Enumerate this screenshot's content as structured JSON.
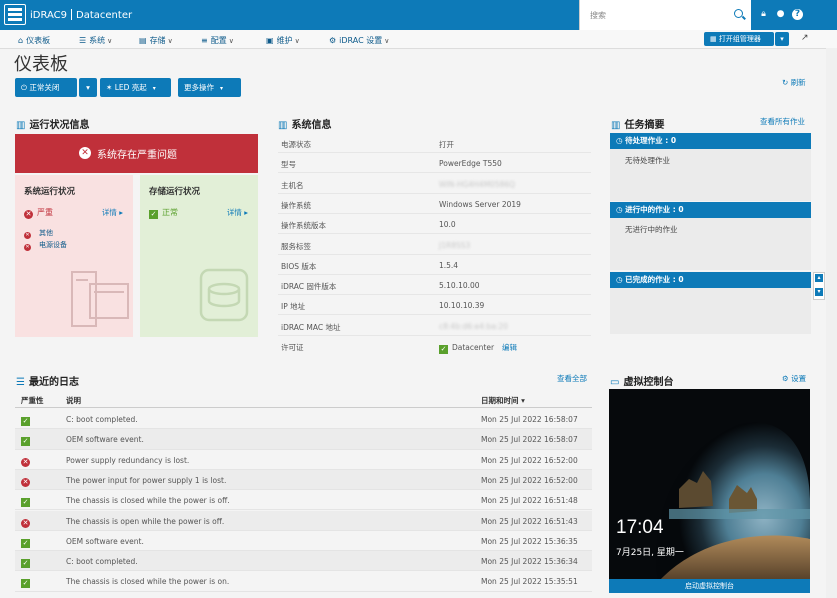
{
  "app": {
    "brand": "iDRAC9",
    "edition": "Datacenter"
  },
  "search": {
    "placeholder": "搜索"
  },
  "nav": [
    {
      "label": "仪表板"
    },
    {
      "label": "系统"
    },
    {
      "label": "存储"
    },
    {
      "label": "配置"
    },
    {
      "label": "维护"
    },
    {
      "label": "iDRAC 设置"
    }
  ],
  "group_manager": {
    "label": "打开组管理器"
  },
  "page": {
    "title": "仪表板",
    "refresh": "刷新"
  },
  "actions": {
    "shutdown": "正常关闭",
    "led": "LED 亮起",
    "more": "更多操作"
  },
  "health": {
    "title": "运行状况信息",
    "alert": "系统存在严重问题",
    "system": {
      "title": "系统运行状况",
      "status": "严重",
      "detail": "详情",
      "items": [
        "其他",
        "电源设备"
      ]
    },
    "storage": {
      "title": "存储运行状况",
      "status": "正常",
      "detail": "详情"
    }
  },
  "sysinfo": {
    "title": "系统信息",
    "rows": [
      {
        "k": "电源状态",
        "v": "打开"
      },
      {
        "k": "型号",
        "v": "PowerEdge T550"
      },
      {
        "k": "主机名",
        "v": "WIN-HG4H4M0586Q"
      },
      {
        "k": "操作系统",
        "v": "Windows Server 2019"
      },
      {
        "k": "操作系统版本",
        "v": "10.0"
      },
      {
        "k": "服务标签",
        "v": "J1R8SS3"
      },
      {
        "k": "BIOS 版本",
        "v": "1.5.4"
      },
      {
        "k": "iDRAC 固件版本",
        "v": "5.10.10.00"
      },
      {
        "k": "IP 地址",
        "v": "10.10.10.39"
      },
      {
        "k": "iDRAC MAC 地址",
        "v": "c8:4b:d6:e4:ba:20"
      },
      {
        "k": "许可证",
        "v": "Datacenter",
        "link": "编辑"
      }
    ]
  },
  "tasks": {
    "title": "任务摘要",
    "view_all": "查看所有作业",
    "pending": {
      "label": "待处理作业 : 0",
      "text": "无待处理作业"
    },
    "running": {
      "label": "进行中的作业 : 0",
      "text": "无进行中的作业"
    },
    "done": {
      "label": "已完成的作业 : 0"
    }
  },
  "logs": {
    "title": "最近的日志",
    "view_all": "查看全部",
    "headers": {
      "severity": "严重性",
      "desc": "说明",
      "date": "日期和时间"
    },
    "rows": [
      {
        "sev": "ok",
        "msg": "C: boot completed.",
        "date": "Mon 25 Jul 2022 16:58:07"
      },
      {
        "sev": "ok",
        "msg": "OEM software event.",
        "date": "Mon 25 Jul 2022 16:58:07"
      },
      {
        "sev": "error",
        "msg": "Power supply redundancy is lost.",
        "date": "Mon 25 Jul 2022 16:52:00"
      },
      {
        "sev": "error",
        "msg": "The power input for power supply 1 is lost.",
        "date": "Mon 25 Jul 2022 16:52:00"
      },
      {
        "sev": "ok",
        "msg": "The chassis is closed while the power is off.",
        "date": "Mon 25 Jul 2022 16:51:48"
      },
      {
        "sev": "error",
        "msg": "The chassis is open while the power is off.",
        "date": "Mon 25 Jul 2022 16:51:43"
      },
      {
        "sev": "ok",
        "msg": "OEM software event.",
        "date": "Mon 25 Jul 2022 15:36:35"
      },
      {
        "sev": "ok",
        "msg": "C: boot completed.",
        "date": "Mon 25 Jul 2022 15:36:34"
      },
      {
        "sev": "ok",
        "msg": "The chassis is closed while the power is on.",
        "date": "Mon 25 Jul 2022 15:35:51"
      }
    ]
  },
  "console": {
    "title": "虚拟控制台",
    "settings": "设置",
    "time": "17:04",
    "date": "7月25日, 星期一",
    "launch": "启动虚拟控制台"
  },
  "colors": {
    "primary": "#0d7ab8",
    "critical": "#c0303a",
    "ok": "#5aa02c"
  }
}
